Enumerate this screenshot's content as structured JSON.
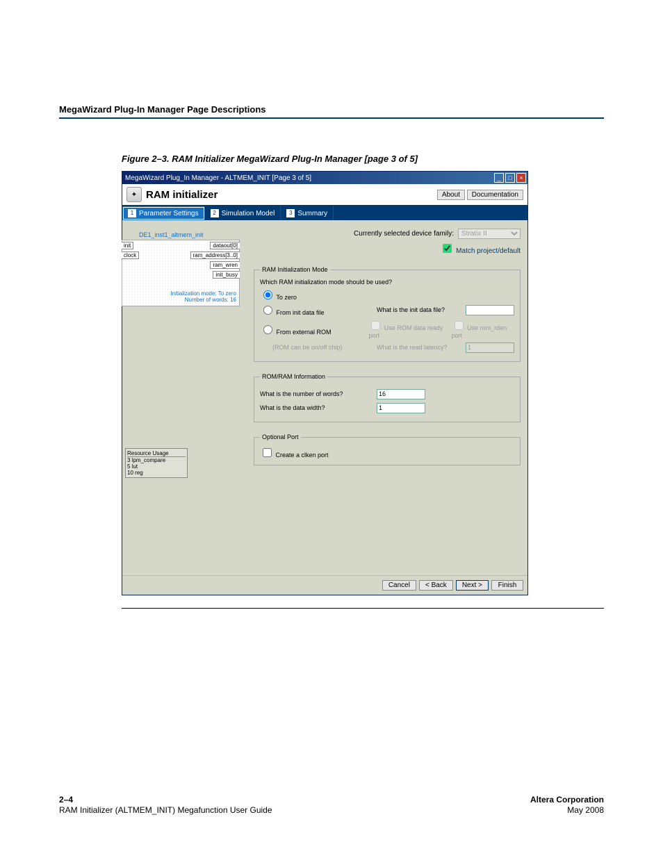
{
  "page_header": "MegaWizard Plug-In Manager Page Descriptions",
  "figure_title": "Figure 2–3. RAM Initializer MegaWizard Plug-In Manager [page 3 of 5]",
  "window": {
    "titlebar": "MegaWizard Plug_In Manager - ALTMEM_INIT [Page 3 of 5]",
    "brand": "RAM initializer",
    "about_btn": "About",
    "docs_btn": "Documentation"
  },
  "tabs": [
    {
      "num": "1",
      "label": "Parameter Settings"
    },
    {
      "num": "2",
      "label": "Simulation Model"
    },
    {
      "num": "3",
      "label": "Summary"
    }
  ],
  "diagram": {
    "instance": "DE1_inst1_altmem_init",
    "left_pins": [
      "init",
      "clock"
    ],
    "right_pins": [
      "dataout[0]",
      "ram_address[3..0]",
      "ram_wren",
      "init_busy"
    ],
    "note1": "Initialization mode: To zero",
    "note2": "Number of words: 16"
  },
  "resource": {
    "title": "Resource Usage",
    "lines": [
      "3 lpm_compare",
      "5 lut",
      "10 reg"
    ]
  },
  "device_label": "Currently selected device family:",
  "device_value": "Stratix II",
  "match_label": "Match project/default",
  "fs_init": {
    "legend": "RAM Initialization Mode",
    "question": "Which RAM initialization mode should be used?",
    "to_zero": "To zero",
    "from_file": "From init data file",
    "what_file": "What is the init data file?",
    "from_rom": "From external ROM",
    "rom_sub": "(ROM can be on/off chip)",
    "use_rom_port": "Use ROM data ready port",
    "use_rden": "Use rom_rden port",
    "latency": "What is the read latency?",
    "latency_val": "1"
  },
  "fs_info": {
    "legend": "ROM/RAM Information",
    "num_words_label": "What is the number of words?",
    "num_words_val": "16",
    "data_width_label": "What is the data width?",
    "data_width_val": "1"
  },
  "fs_opt": {
    "legend": "Optional Port",
    "clken": "Create a clken port"
  },
  "footer_buttons": {
    "cancel": "Cancel",
    "back": "< Back",
    "next": "Next >",
    "finish": "Finish"
  },
  "footer": {
    "page_left1": "2–4",
    "page_left2": "RAM Initializer (ALTMEM_INIT) Megafunction User Guide",
    "page_right1": "Altera Corporation",
    "page_right2": "May 2008"
  }
}
